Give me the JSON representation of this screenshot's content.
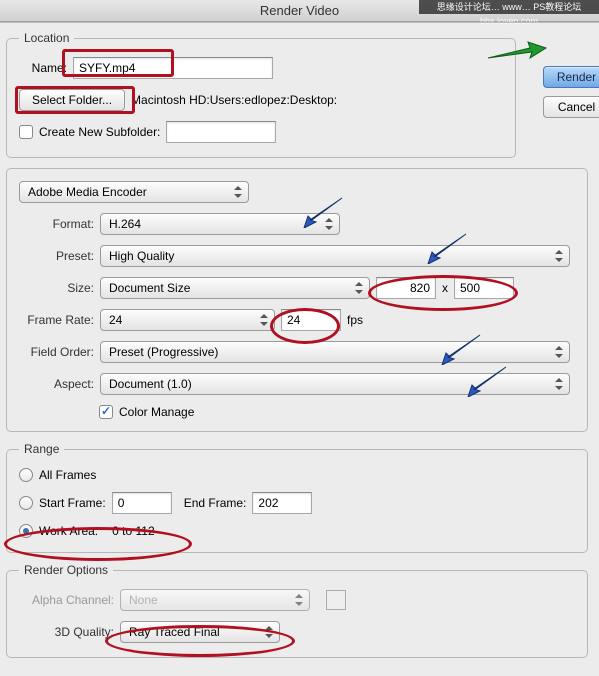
{
  "window": {
    "title": "Render Video"
  },
  "watermark": "思缘设计论坛… www… PS教程论坛 bbs.loveo.com",
  "buttons": {
    "render": "Render",
    "cancel": "Cancel"
  },
  "location": {
    "legend": "Location",
    "name_label": "Name:",
    "name_value": "SYFY.mp4",
    "select_folder": "Select Folder...",
    "path": "Macintosh HD:Users:edlopez:Desktop:",
    "new_subfolder_label": "Create New Subfolder:",
    "new_subfolder_value": ""
  },
  "encoder": {
    "module": "Adobe Media Encoder",
    "format_label": "Format:",
    "format_value": "H.264",
    "preset_label": "Preset:",
    "preset_value": "High Quality",
    "size_label": "Size:",
    "size_mode": "Document Size",
    "size_w": "820",
    "size_x": "x",
    "size_h": "500",
    "framerate_label": "Frame Rate:",
    "framerate_value": "24",
    "framerate_value2": "24",
    "framerate_unit": "fps",
    "fieldorder_label": "Field Order:",
    "fieldorder_value": "Preset (Progressive)",
    "aspect_label": "Aspect:",
    "aspect_value": "Document (1.0)",
    "color_manage": "Color Manage"
  },
  "range": {
    "legend": "Range",
    "all_frames": "All Frames",
    "start_frame_label": "Start Frame:",
    "start_frame_value": "0",
    "end_frame_label": "End Frame:",
    "end_frame_value": "202",
    "work_area_label": "Work Area:",
    "work_area_value": "0 to 112"
  },
  "render_options": {
    "legend": "Render Options",
    "alpha_label": "Alpha Channel:",
    "alpha_value": "None",
    "quality_label": "3D Quality:",
    "quality_value": "Ray Traced Final"
  }
}
